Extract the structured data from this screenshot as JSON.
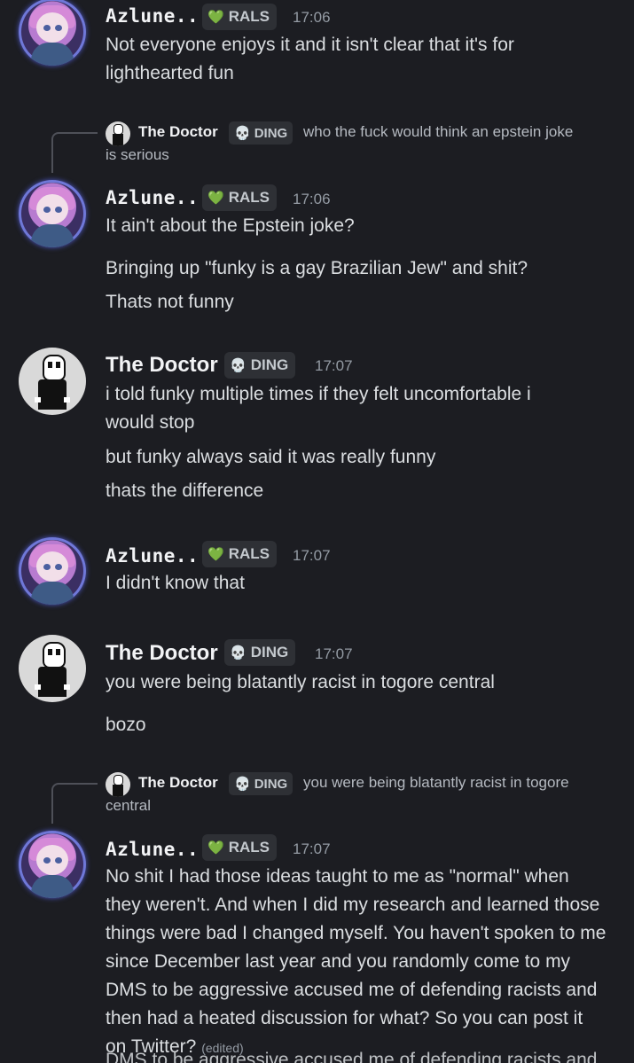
{
  "azlune": {
    "name": "Azlune...",
    "tag": "RALS",
    "tag_icon": "heart-icon"
  },
  "doctor": {
    "name": "The Doctor",
    "tag": "DING",
    "tag_icon": "skull-icon"
  },
  "messages": [
    {
      "time": "17:06",
      "lines": [
        "Not everyone enjoys it and it isn't clear that it's for",
        "lighthearted fun"
      ]
    },
    {
      "reply_text_1": "who the fuck would think an epstein joke",
      "reply_text_2": "is serious"
    },
    {
      "time": "17:06",
      "lines": [
        "It ain't about the Epstein joke?",
        "Bringing up \"funky is a gay Brazilian Jew\" and shit?",
        "Thats not funny"
      ]
    },
    {
      "time": "17:07",
      "lines": [
        "i told funky multiple times if they felt uncomfortable i",
        "would stop",
        "but funky always said it was really funny",
        "thats the difference"
      ]
    },
    {
      "time": "17:07",
      "lines": [
        "I didn't know that"
      ]
    },
    {
      "time": "17:07",
      "lines": [
        "you were being blatantly racist in togore central",
        "bozo"
      ]
    },
    {
      "reply_text_1": "you were being blatantly racist in togore",
      "reply_text_2": "central"
    },
    {
      "time": "17:07",
      "lines": [
        "No shit I had those ideas taught to me as \"normal\" when",
        "they weren't. And when I did my research and learned those",
        "things were bad I changed myself. You haven't spoken to me",
        "since December last year and you randomly come to my",
        "DMS to be aggressive accused me of defending racists and",
        "then had a heated discussion for what? So you can post it",
        "on Twitter?"
      ],
      "edited": "(edited)"
    }
  ],
  "cut_off_line": "DMS to be aggressive accused me of defending racists and"
}
